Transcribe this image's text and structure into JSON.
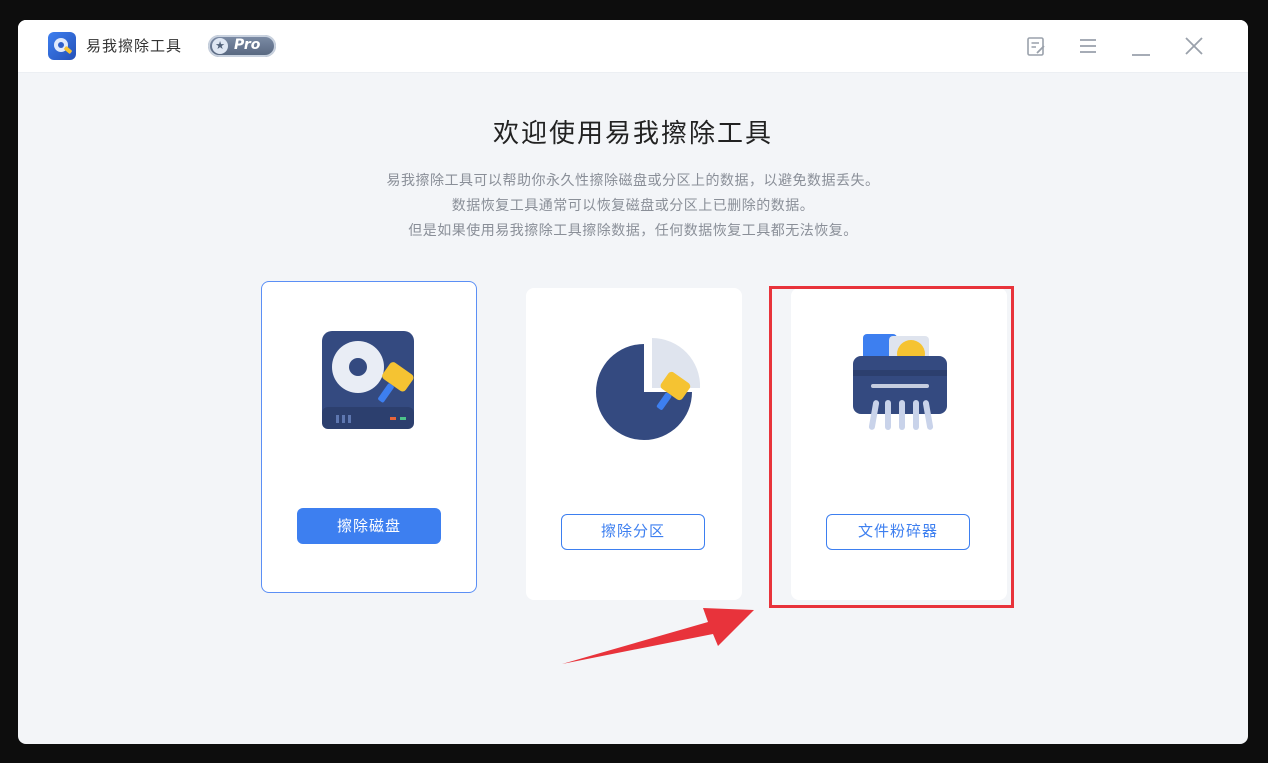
{
  "titlebar": {
    "app_name": "易我擦除工具",
    "badge": "Pro",
    "buttons": [
      "feedback-icon",
      "menu-icon",
      "minimize-icon",
      "close-icon"
    ]
  },
  "main": {
    "title": "欢迎使用易我擦除工具",
    "description": [
      "易我擦除工具可以帮助你永久性擦除磁盘或分区上的数据，以避免数据丢失。",
      "数据恢复工具通常可以恢复磁盘或分区上已删除的数据。",
      "但是如果使用易我擦除工具擦除数据，任何数据恢复工具都无法恢复。"
    ],
    "cards": [
      {
        "icon": "disk-eraser-icon",
        "button_label": "擦除磁盘",
        "selected": true
      },
      {
        "icon": "partition-eraser-icon",
        "button_label": "擦除分区",
        "selected": false
      },
      {
        "icon": "file-shredder-icon",
        "button_label": "文件粉碎器",
        "selected": false
      }
    ]
  },
  "colors": {
    "accent": "#3d7ff0",
    "annotation_red": "#e8333b",
    "icon_navy": "#344a80",
    "icon_yellow": "#f5c332"
  }
}
